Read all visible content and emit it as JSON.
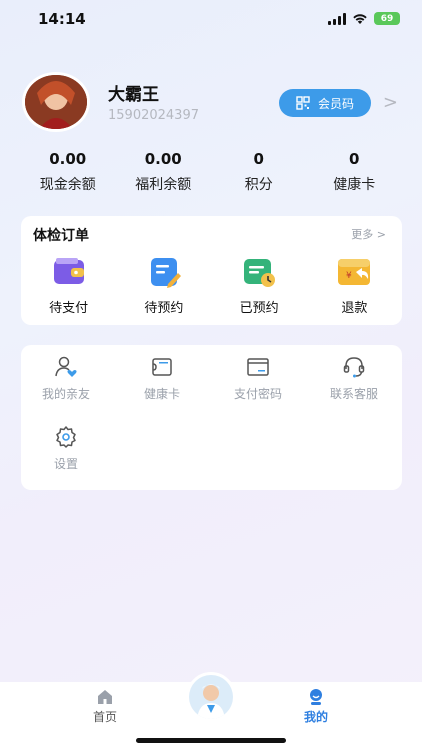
{
  "status_bar": {
    "time": "14:14",
    "battery": "69"
  },
  "profile": {
    "name": "大霸王",
    "phone": "15902024397",
    "member_code_label": "会员码"
  },
  "stats": [
    {
      "value": "0.00",
      "label": "现金余额"
    },
    {
      "value": "0.00",
      "label": "福利余额"
    },
    {
      "value": "0",
      "label": "积分"
    },
    {
      "value": "0",
      "label": "健康卡"
    }
  ],
  "orders": {
    "title": "体检订单",
    "more": "更多 >",
    "items": [
      {
        "label": "待支付",
        "icon": "wallet-icon"
      },
      {
        "label": "待预约",
        "icon": "clipboard-pen-icon"
      },
      {
        "label": "已预约",
        "icon": "calendar-clock-icon"
      },
      {
        "label": "退款",
        "icon": "refund-icon"
      }
    ]
  },
  "tools": {
    "items": [
      {
        "label": "我的亲友",
        "icon": "user-heart-icon"
      },
      {
        "label": "健康卡",
        "icon": "card-icon"
      },
      {
        "label": "支付密码",
        "icon": "password-icon"
      },
      {
        "label": "联系客服",
        "icon": "headset-icon"
      },
      {
        "label": "设置",
        "icon": "gear-icon"
      }
    ]
  },
  "tabbar": {
    "home": "首页",
    "mine": "我的"
  },
  "colors": {
    "accent": "#3d9be9",
    "tab_active": "#2f7fe0",
    "muted": "#9aa0aa"
  }
}
